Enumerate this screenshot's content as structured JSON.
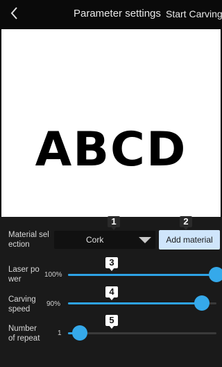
{
  "header": {
    "title": "Parameter settings",
    "start_label": "Start Carving"
  },
  "canvas": {
    "text": "ABCD"
  },
  "material": {
    "label": "Material sel\nection",
    "value": "Cork",
    "add_label": "Add material"
  },
  "laser_power": {
    "label": "Laser po\nwer",
    "value_text": "100%",
    "value": 1.0
  },
  "carving_speed": {
    "label": "Carving\nspeed",
    "value_text": "90%",
    "value": 0.9
  },
  "repeat": {
    "label": "Number\nof repeat",
    "value_text": "1",
    "value": 0.08
  },
  "markers": [
    "1",
    "2",
    "3",
    "4",
    "5"
  ],
  "colors": {
    "accent": "#2ea3e6",
    "button_bg": "#cfe5fb",
    "panel_bg": "#1a1a1a"
  },
  "icons": {
    "back": "chevron-left-icon"
  }
}
